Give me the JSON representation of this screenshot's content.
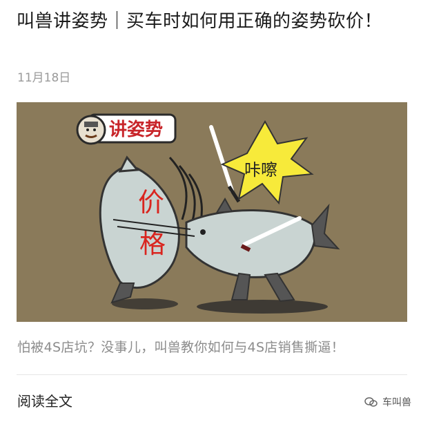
{
  "article": {
    "title": "叫兽讲姿势｜买车时如何用正确的姿势砍价！",
    "date": "11月18日",
    "summary": "怕被4S店坑？没事儿，叫兽教你如何与4S店销售撕逼！",
    "read_all": "阅读全文"
  },
  "cover": {
    "badge_text": "讲姿势",
    "burst_text": "咔嚓",
    "fish_text_top": "价",
    "fish_text_bottom": "格"
  },
  "watermark": {
    "text": "车叫兽",
    "icon": "wechat-icon"
  },
  "colors": {
    "background": "#8a7a5a",
    "fish": "#c9d4d2",
    "burst": "#f7ea3a",
    "text_red": "#d9251f"
  }
}
